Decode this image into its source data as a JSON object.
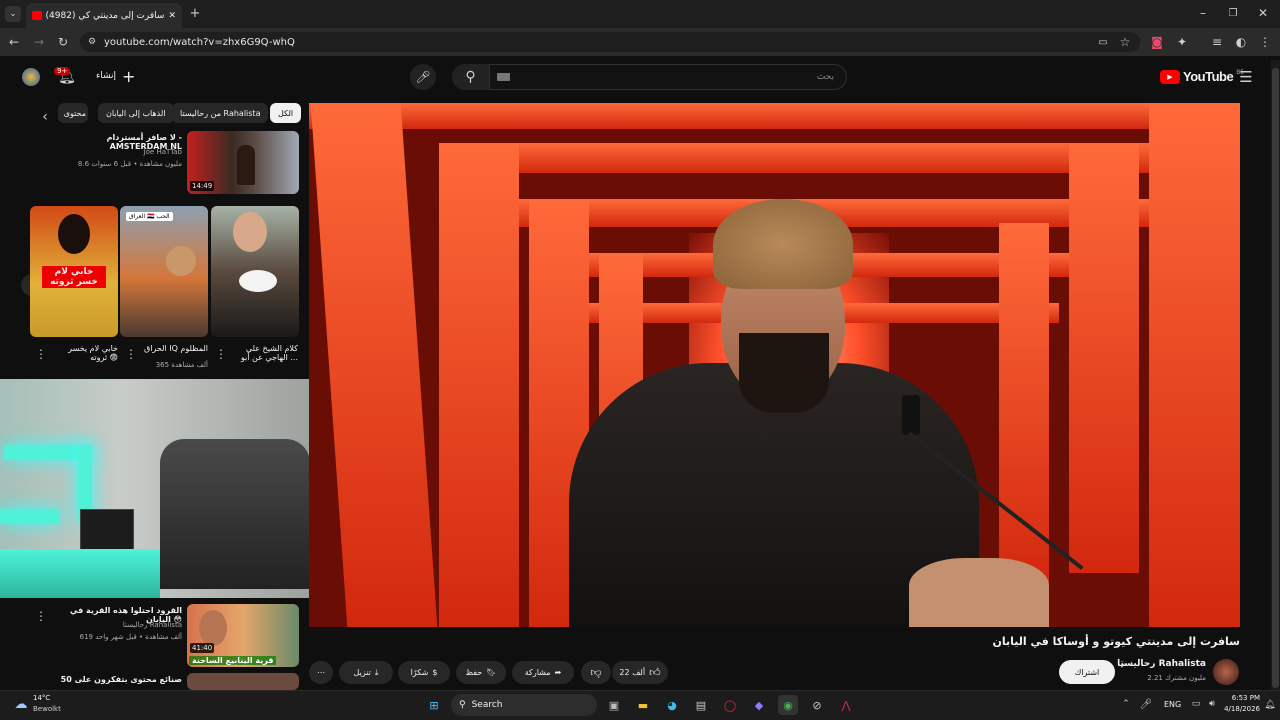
{
  "browser": {
    "tab_title": "(4982) سافرت إلى مدينتي كي",
    "url": "youtube.com/watch?v=zhx6G9Q-whQ"
  },
  "header": {
    "create_label": "إنشاء",
    "notif_badge": "9+",
    "search_placeholder": "بحث",
    "logo": "YouTube",
    "region": "BE"
  },
  "chips": [
    "الكل",
    "من رحاليستا Rahalista",
    "الذهاب إلى اليابان",
    "محتوى"
  ],
  "sidebar": {
    "top_card": {
      "title": "لا صافر أمستردام - AMSTERDAM NL",
      "channel": "Joe HaTTab",
      "stats": "8.6 مليون مشاهدة • قبل 6 سنوات",
      "duration": "14:49"
    },
    "shorts": [
      {
        "title": "كلام الشيخ علي الهاجي عن أبو ...",
        "views": "..."
      },
      {
        "title": "الحراق IQ المظلوم",
        "views": "365 ألف مشاهدة",
        "overlay": "العراق 🇮🇶 الحب"
      },
      {
        "title": "خابي لام يخسر ثروته 😨",
        "views": "...",
        "overlay": "خابي لام خسر ثروته"
      }
    ],
    "bottom_card": {
      "title": "القرود احتلوا هذه القرية في اليابان 😳",
      "channel": "رحاليستا Rahalista",
      "stats": "619 ألف مشاهدة • قبل شهر واحد",
      "duration": "41:40",
      "overlay": "قرية الينابيع الساخنة"
    },
    "next_title": "50 صنائع محتوى بتفكرون على"
  },
  "video": {
    "title": "سافرت إلى مدينتي كيوتو و أوساكا في اليابان",
    "channel": "رحاليستا Rahalista",
    "subscribers": "2.21 مليون مشترك",
    "subscribe_label": "اشتراك",
    "likes": "22 ألف",
    "share_label": "مشاركة",
    "save_label": "حفظ",
    "thanks_label": "شكرًا",
    "download_label": "تنزيل"
  },
  "taskbar": {
    "temp": "14°C",
    "weather": "Bewolkt",
    "search": "Search",
    "lang": "ENG",
    "time": "6:53 PM",
    "date": "4/18/2026"
  }
}
